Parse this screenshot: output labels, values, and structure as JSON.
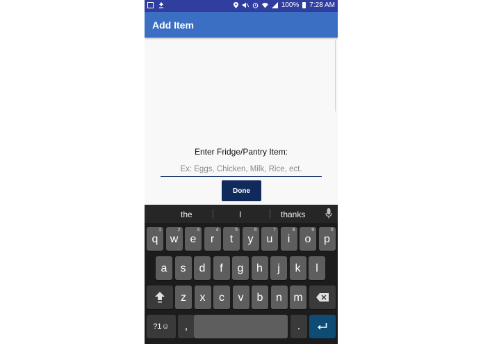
{
  "status_bar": {
    "battery": "100%",
    "time": "7:28 AM"
  },
  "app_bar": {
    "title": "Add Item"
  },
  "form": {
    "prompt": "Enter Fridge/Pantry Item:",
    "placeholder": "Ex: Eggs, Chicken, Milk, Rice, ect.",
    "value": "",
    "done_label": "Done"
  },
  "keyboard": {
    "suggestions": [
      "the",
      "I",
      "thanks"
    ],
    "row1": [
      {
        "label": "q",
        "num": "1"
      },
      {
        "label": "w",
        "num": "2"
      },
      {
        "label": "e",
        "num": "3"
      },
      {
        "label": "r",
        "num": "4"
      },
      {
        "label": "t",
        "num": "5"
      },
      {
        "label": "y",
        "num": "6"
      },
      {
        "label": "u",
        "num": "7"
      },
      {
        "label": "i",
        "num": "8"
      },
      {
        "label": "o",
        "num": "9"
      },
      {
        "label": "p",
        "num": "0"
      }
    ],
    "row2": [
      "a",
      "s",
      "d",
      "f",
      "g",
      "h",
      "j",
      "k",
      "l"
    ],
    "row3": [
      "z",
      "x",
      "c",
      "v",
      "b",
      "n",
      "m"
    ],
    "symbols_label": "?1☺",
    "comma_label": ",",
    "period_label": ".",
    "colors": {
      "enter": "#0f4c75",
      "key": "#5e5e5e",
      "key_dark": "#3a3a3a"
    }
  }
}
